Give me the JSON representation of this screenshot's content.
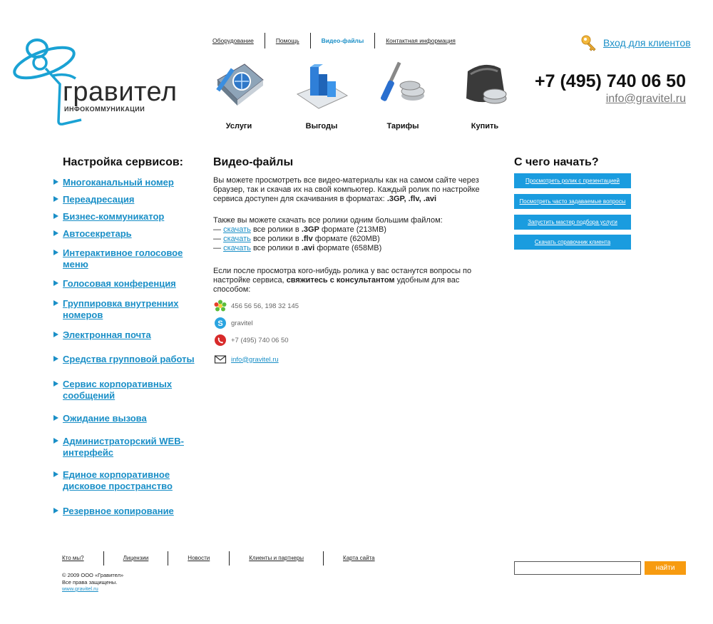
{
  "logo": {
    "name": "гравител",
    "subtitle": "ИНФОКОММУНИКАЦИИ"
  },
  "topnav": [
    {
      "label": "Оборудование"
    },
    {
      "label": "Помощь"
    },
    {
      "label": "Видео-файлы",
      "active": true
    },
    {
      "label": "Контактная информация"
    }
  ],
  "login": {
    "label": "Вход для клиентов",
    "icon": "key-icon"
  },
  "contact_header": {
    "phone": "+7 (495) 740 06 50",
    "email": "info@gravitel.ru"
  },
  "services": [
    {
      "label": "Услуги",
      "icon": "book-globe-icon"
    },
    {
      "label": "Выгоды",
      "icon": "bar-chart-icon"
    },
    {
      "label": "Тарифы",
      "icon": "tools-coins-icon"
    },
    {
      "label": "Купить",
      "icon": "wallet-coins-icon"
    }
  ],
  "sidebar": {
    "title": "Настройка сервисов:",
    "items": [
      {
        "label": "Многоканальный номер"
      },
      {
        "label": "Переадресация"
      },
      {
        "label": "Бизнес-коммуникатор"
      },
      {
        "label": "Автосекретарь"
      },
      {
        "label": "Интерактивное голосовое меню"
      },
      {
        "label": "Голосовая конференция"
      },
      {
        "label": "Группировка внутренних номеров"
      },
      {
        "label": "Электронная почта"
      },
      {
        "label": "Средства групповой работы"
      },
      {
        "label": "Сервис корпоративных сообщений"
      },
      {
        "label": "Ожидание вызова"
      },
      {
        "label": "Администраторский WEB-интерфейс"
      },
      {
        "label": "Единое корпоративное дисковое пространство"
      },
      {
        "label": "Резервное копирование"
      }
    ]
  },
  "main": {
    "title": "Видео-файлы",
    "intro": "Вы можете просмотреть все видео-материалы как на самом сайте через браузер, так и скачав их на свой компьютер. Каждый ролик по настройке сервиса доступен для скачивания в форматах:",
    "formats": ".3GP, .flv, .avi",
    "download_intro": "Также вы можете скачать все ролики одним большим файлом:",
    "download_link": "скачать",
    "downloads": [
      {
        "dash": "—",
        "text_before": "все ролики в",
        "format": ".3GP",
        "text_after": "формате (213MB)"
      },
      {
        "dash": "—",
        "text_before": "все ролики в",
        "format": ".flv",
        "text_after": "формате (620MB)"
      },
      {
        "dash": "—",
        "text_before": "все ролики в",
        "format": ".avi",
        "text_after": "формате (658MB)"
      }
    ],
    "question_text": "Если после просмотра кого-нибудь ролика у вас останутся вопросы по настройке сервиса,",
    "question_bold": "свяжитесь с консультантом",
    "question_end": "удобным для вас способом:",
    "contacts": [
      {
        "icon": "icq-flower-icon",
        "text": "456 56 56, 198 32 145"
      },
      {
        "icon": "skype-icon",
        "text": "gravitel"
      },
      {
        "icon": "phone-call-icon",
        "text": "+7 (495) 740 06 50"
      },
      {
        "icon": "envelope-icon",
        "text": "info@gravitel.ru",
        "link": true
      }
    ]
  },
  "right": {
    "title": "С чего начать?",
    "buttons": [
      {
        "label": "Просмотреть ролик с презентацией"
      },
      {
        "label": "Посмотреть часто задаваемые вопросы"
      },
      {
        "label": "Запустить мастер подбора услуги"
      },
      {
        "label": "Скачать справочник клиента"
      }
    ]
  },
  "footer": {
    "nav": [
      {
        "label": "Кто мы?"
      },
      {
        "label": "Лицензии"
      },
      {
        "label": "Новости"
      },
      {
        "label": "Клиенты и партнеры"
      },
      {
        "label": "Карта сайта"
      }
    ],
    "copyright": "© 2009 ООО «Гравител»",
    "rights": "Все права защищены.",
    "site": "www.gravitel.ru",
    "search_value": "",
    "search_button": "найти"
  },
  "colors": {
    "accent": "#1a8fc7",
    "button_blue": "#1a9cdf",
    "search_orange": "#f79b10"
  }
}
